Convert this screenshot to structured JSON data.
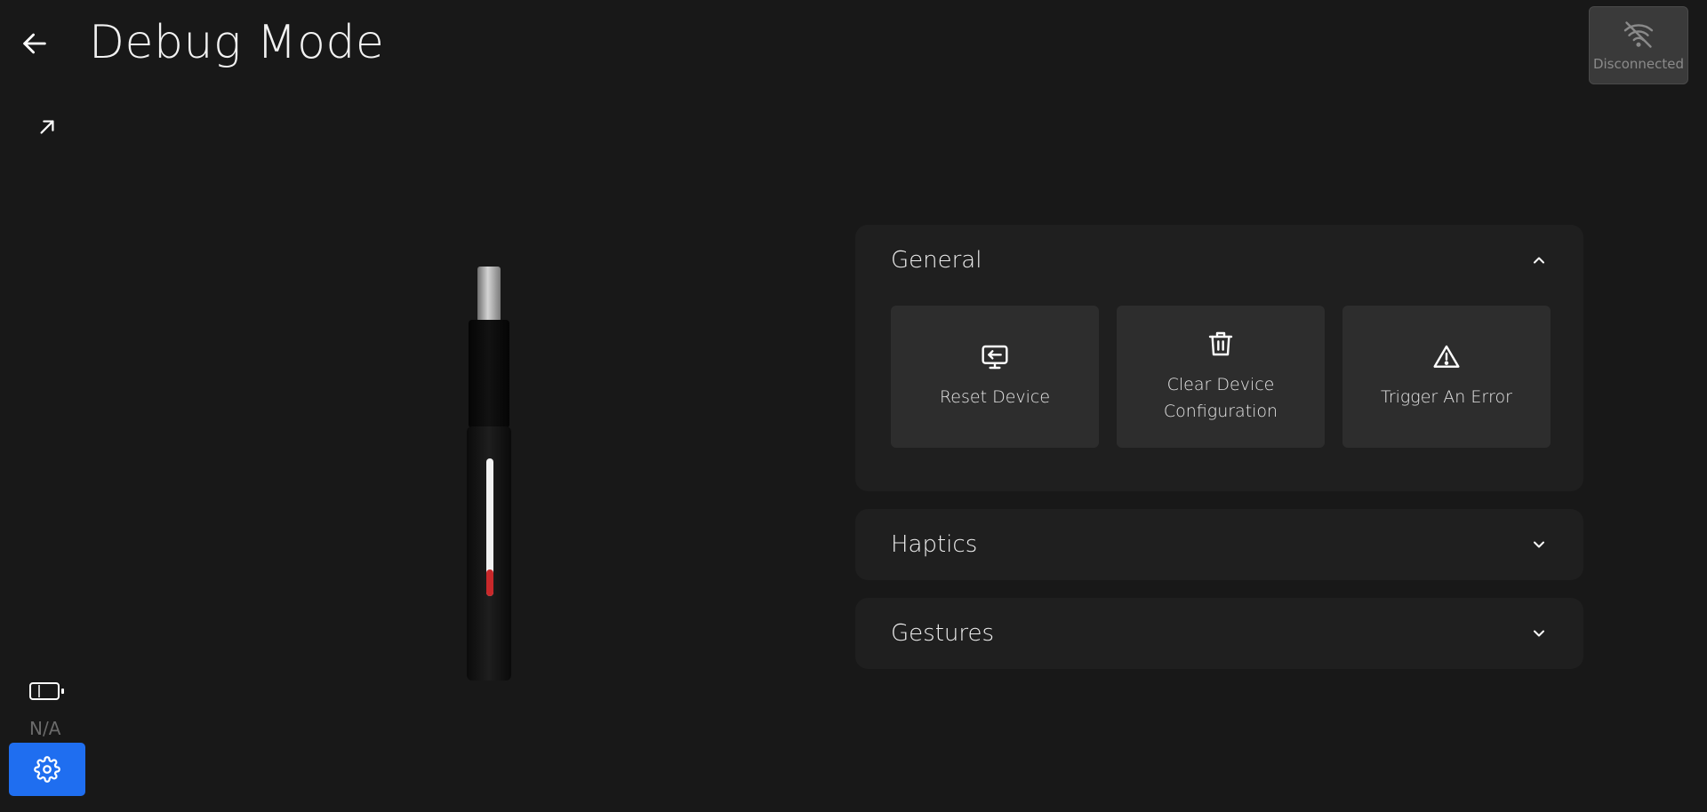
{
  "header": {
    "title": "Debug Mode",
    "back_icon": "arrow-left-icon",
    "expand_icon": "arrow-up-right-icon"
  },
  "connection": {
    "status": "Disconnected",
    "icon": "wifi-off-icon"
  },
  "battery": {
    "icon": "battery-empty-icon",
    "value": "N/A"
  },
  "settings": {
    "icon": "gear-icon",
    "color": "#1f6ef0"
  },
  "sections": {
    "general": {
      "title": "General",
      "expanded": true,
      "actions": [
        {
          "label": "Reset Device",
          "icon": "screen-reset-icon"
        },
        {
          "label": "Clear Device Configuration",
          "icon": "trash-icon"
        },
        {
          "label": "Trigger An Error",
          "icon": "warning-triangle-icon"
        }
      ]
    },
    "haptics": {
      "title": "Haptics",
      "expanded": false
    },
    "gestures": {
      "title": "Gestures",
      "expanded": false
    }
  }
}
